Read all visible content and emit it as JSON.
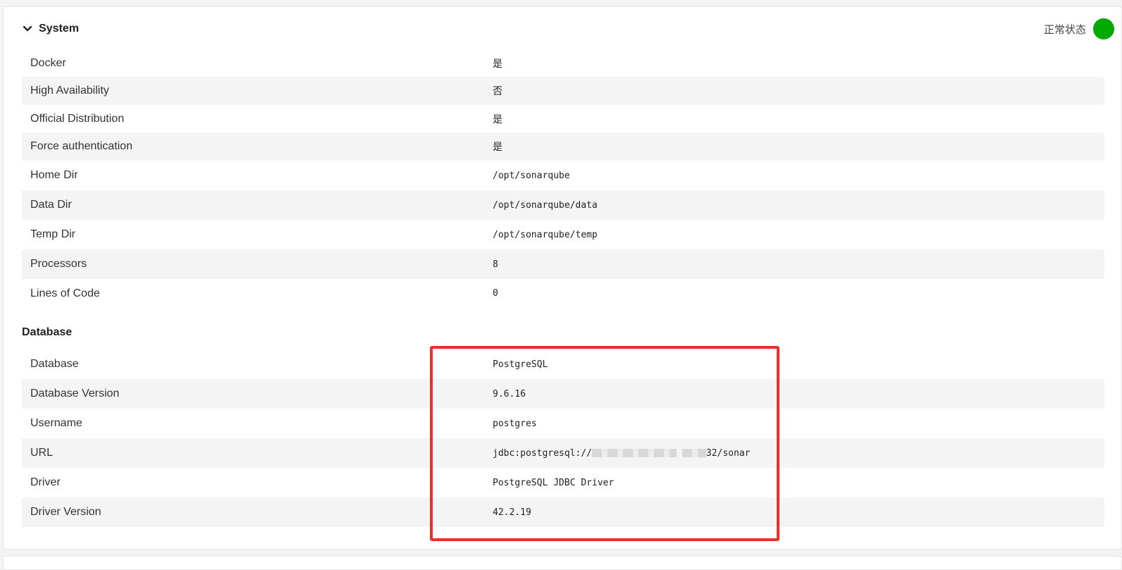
{
  "section": {
    "title": "System",
    "health_label": "正常状态",
    "health_color": "#00aa00",
    "toggle_icon": "chevron-down-icon"
  },
  "system_rows": [
    {
      "label": "Docker",
      "value": "是"
    },
    {
      "label": "High Availability",
      "value": "否"
    },
    {
      "label": "Official Distribution",
      "value": "是"
    },
    {
      "label": "Force authentication",
      "value": "是"
    },
    {
      "label": "Home Dir",
      "value": "/opt/sonarqube"
    },
    {
      "label": "Data Dir",
      "value": "/opt/sonarqube/data"
    },
    {
      "label": "Temp Dir",
      "value": "/opt/sonarqube/temp"
    },
    {
      "label": "Processors",
      "value": "8"
    },
    {
      "label": "Lines of Code",
      "value": "0"
    }
  ],
  "database": {
    "heading": "Database",
    "rows": [
      {
        "label": "Database",
        "value": "PostgreSQL"
      },
      {
        "label": "Database Version",
        "value": "9.6.16"
      },
      {
        "label": "Username",
        "value": "postgres"
      },
      {
        "label": "URL",
        "value_prefix": "jdbc:postgresql://",
        "value_suffix": "32/sonar"
      },
      {
        "label": "Driver",
        "value": "PostgreSQL JDBC Driver"
      },
      {
        "label": "Driver Version",
        "value": "42.2.19"
      }
    ]
  },
  "annotation_color": "#e8312a"
}
